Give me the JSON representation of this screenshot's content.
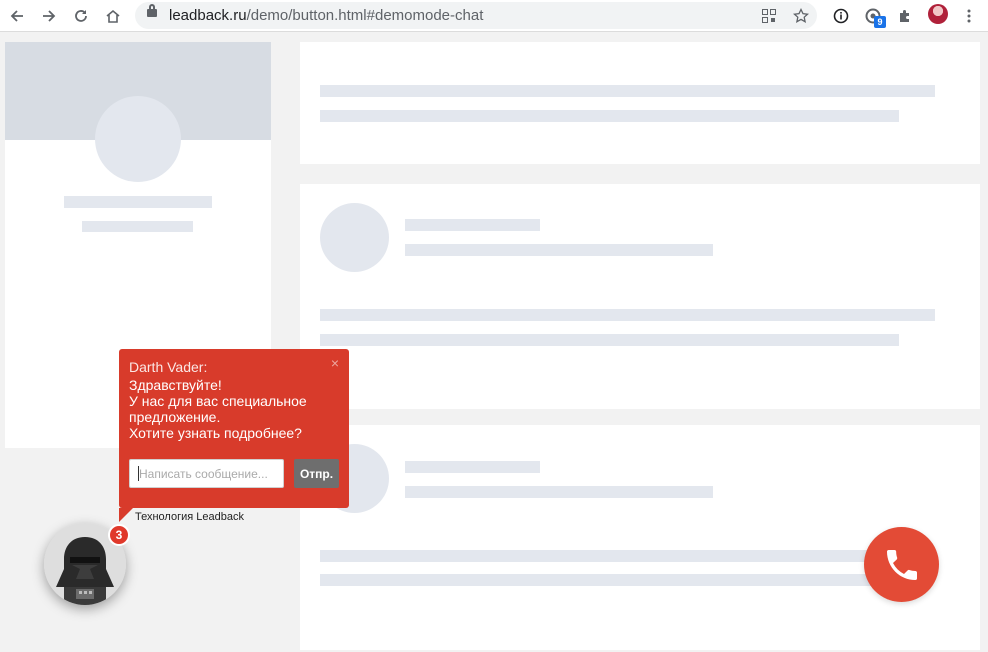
{
  "browser": {
    "url_host": "leadback.ru",
    "url_path": "/demo/button.html#demomode-chat",
    "extension_badge": "9",
    "icons": {
      "back": "arrow-left-icon",
      "forward": "arrow-right-icon",
      "reload": "reload-icon",
      "home": "home-icon",
      "lock": "lock-icon",
      "qr": "qr-code-icon",
      "star": "star-icon",
      "info": "info-icon",
      "extension": "circle-extension-icon",
      "puzzle": "puzzle-icon",
      "profile": "profile-avatar-icon",
      "menu": "more-vert-icon"
    }
  },
  "chat_popup": {
    "sender": "Darth Vader:",
    "message": "Здравствуйте!\nУ нас для вас специальное предложение.\nХотите узнать подробнее?",
    "input_placeholder": "Написать сообщение...",
    "send_label": "Отпр.",
    "close_glyph": "×",
    "powered_by": "Технология Leadback",
    "color": "#d83b2b"
  },
  "avatar": {
    "unread_count": "3"
  },
  "call_button": {
    "icon": "phone-icon",
    "color": "#e34b36"
  },
  "colors": {
    "placeholder": "#e3e7ee",
    "page_bg": "#f2f2f2"
  }
}
